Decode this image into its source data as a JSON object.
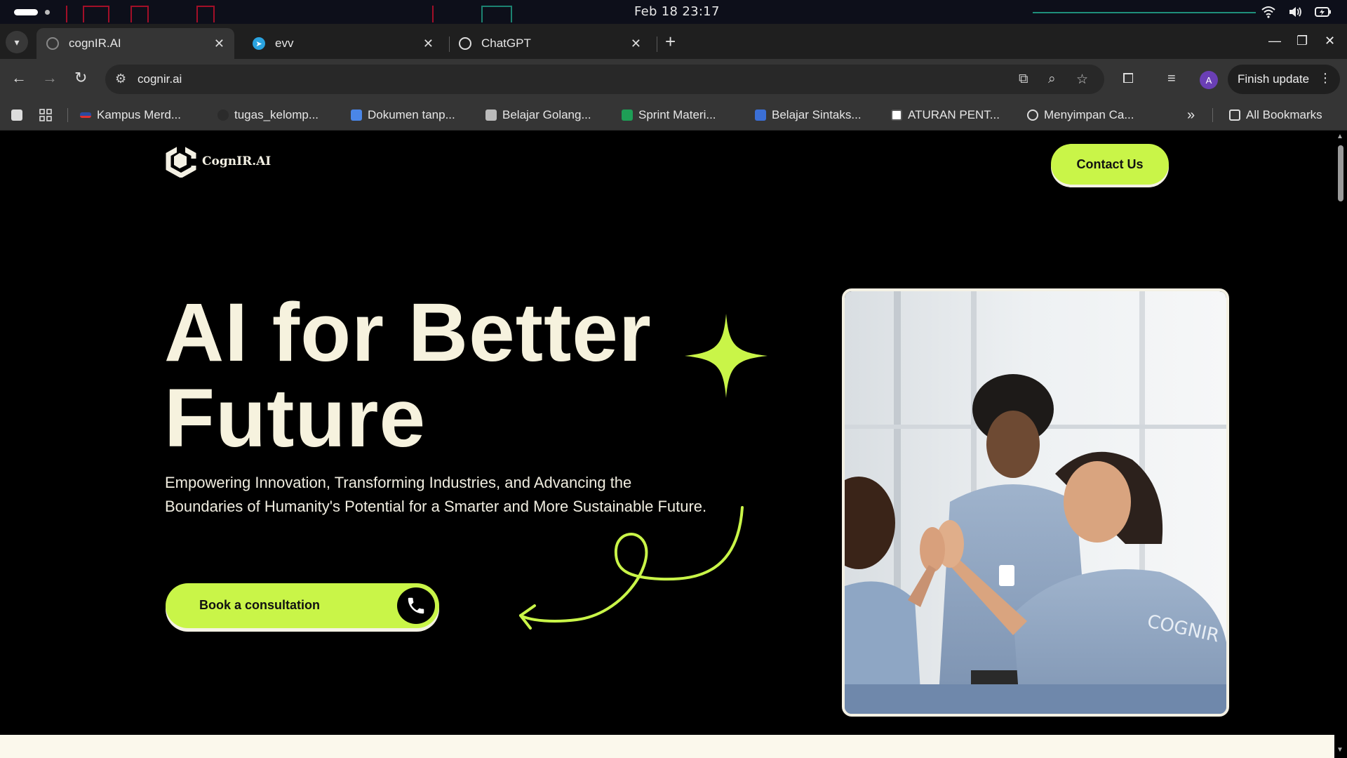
{
  "os": {
    "clock": "Feb 18  23:17"
  },
  "tabs": [
    {
      "title": "cognIR.AI",
      "active": true
    },
    {
      "title": "evv",
      "active": false
    },
    {
      "title": "ChatGPT",
      "active": false
    }
  ],
  "toolbar": {
    "url": "cognir.ai",
    "avatar_letter": "A",
    "finish_update": "Finish update"
  },
  "bookmarks": [
    {
      "label": "Kampus Merd..."
    },
    {
      "label": "tugas_kelomp..."
    },
    {
      "label": "Dokumen tanp..."
    },
    {
      "label": "Belajar Golang..."
    },
    {
      "label": "Sprint Materi..."
    },
    {
      "label": "Belajar Sintaks..."
    },
    {
      "label": "ATURAN PENT..."
    },
    {
      "label": "Menyimpan Ca..."
    }
  ],
  "bookmarks_all": "All Bookmarks",
  "site": {
    "logo_text": "CognIR.AI",
    "contact_label": "Contact Us",
    "hero_line1": "AI for Better",
    "hero_line2": "Future",
    "subtitle": "Empowering Innovation, Transforming Industries, and Advancing the Boundaries of Humanity's Potential for a Smarter and More Sustainable Future.",
    "cta_label": "Book a consultation",
    "shirt_text": "COGNIR"
  },
  "colors": {
    "accent": "#c9f548",
    "cream": "#f4f1e4",
    "background": "#000000"
  }
}
